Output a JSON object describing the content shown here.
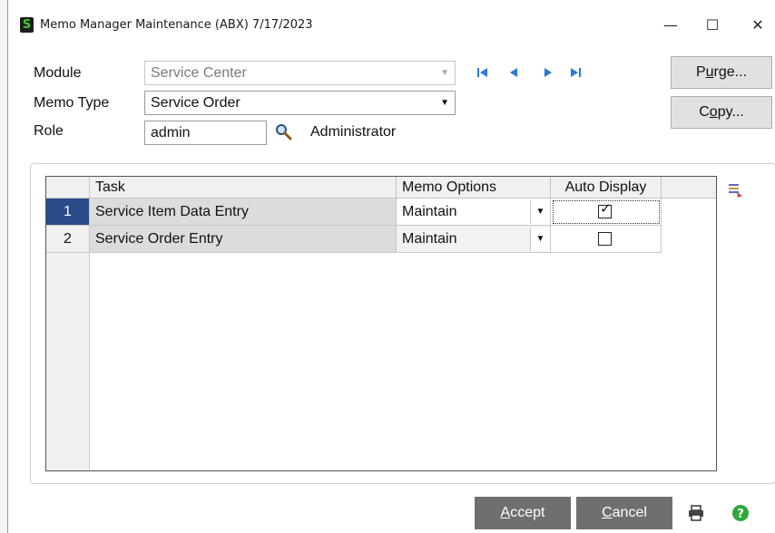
{
  "window": {
    "app_icon_letter": "S",
    "title": "Memo Manager Maintenance (ABX) 7/17/2023",
    "minimize": "—",
    "maximize": "☐",
    "close": "✕"
  },
  "form": {
    "module_label": "Module",
    "module_value": "Service Center",
    "memo_type_label": "Memo Type",
    "memo_type_value": "Service Order",
    "role_label": "Role",
    "role_value": "admin",
    "role_description": "Administrator"
  },
  "nav": {
    "first": "first-record-icon",
    "previous": "previous-record-icon",
    "next": "next-record-icon",
    "last": "last-record-icon"
  },
  "side_buttons": {
    "purge_pre": "P",
    "purge_ul": "u",
    "purge_post": "rge...",
    "copy_pre": "C",
    "copy_ul": "o",
    "copy_post": "py..."
  },
  "grid": {
    "headers": {
      "task": "Task",
      "memo_options": "Memo Options",
      "auto_display": "Auto Display"
    },
    "rows": [
      {
        "num": "1",
        "task": "Service Item Data Entry",
        "memo_option": "Maintain",
        "auto_display": true
      },
      {
        "num": "2",
        "task": "Service Order Entry",
        "memo_option": "Maintain",
        "auto_display": false
      }
    ]
  },
  "bottom": {
    "accept_ul": "A",
    "accept_rest": "ccept",
    "cancel_ul": "C",
    "cancel_rest": "ancel"
  },
  "colors": {
    "nav_accent": "#2b78d6",
    "active_row": "#2a4a8a",
    "bottom_button": "#6f6f6f",
    "help": "#2fa83a"
  }
}
